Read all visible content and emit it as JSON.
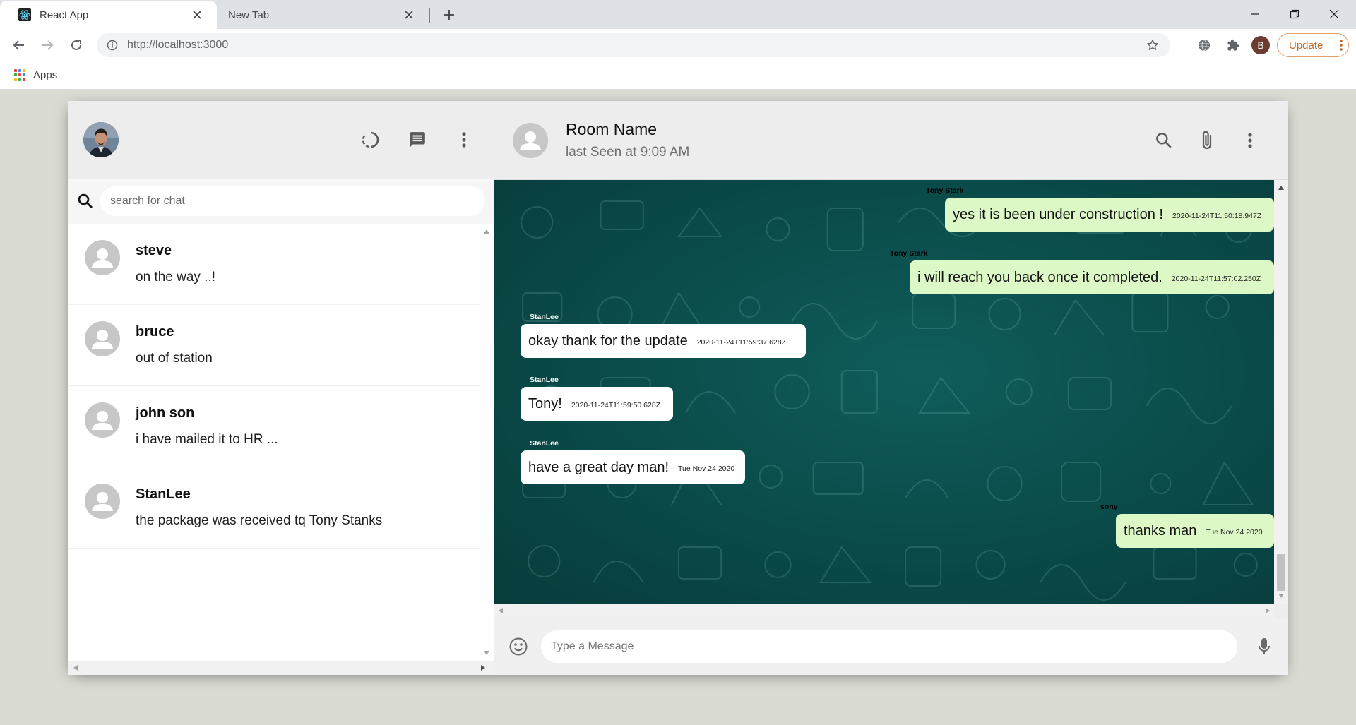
{
  "browser": {
    "tabs": [
      {
        "title": "React App",
        "active": true
      },
      {
        "title": "New Tab",
        "active": false
      }
    ],
    "url": "http://localhost:3000",
    "profile_initial": "B",
    "update_label": "Update",
    "bookmarks": [
      {
        "label": "Apps"
      }
    ]
  },
  "sidebar": {
    "search_placeholder": "search for chat",
    "chats": [
      {
        "name": "steve",
        "last_message": "on the way ..!"
      },
      {
        "name": "bruce",
        "last_message": "out of station"
      },
      {
        "name": "john son",
        "last_message": "i have mailed it to HR ..."
      },
      {
        "name": "StanLee",
        "last_message": "the package was received tq Tony Stanks"
      }
    ]
  },
  "chat": {
    "room_name": "Room Name",
    "last_seen": "last Seen at 9:09 AM",
    "input_placeholder": "Type a Message",
    "messages": [
      {
        "sender": "Tony Stark",
        "text": "yes it is been under construction !",
        "timestamp": "2020-11-24T11:50:18.947Z",
        "type": "sent"
      },
      {
        "sender": "Tony Stark",
        "text": "i will reach you back once it completed.",
        "timestamp": "2020-11-24T11:57:02.250Z",
        "type": "sent"
      },
      {
        "sender": "StanLee",
        "text": "okay thank for the update",
        "timestamp": "2020-11-24T11:59:37.628Z",
        "type": "received"
      },
      {
        "sender": "StanLee",
        "text": "Tony!",
        "timestamp": "2020-11-24T11:59:50.628Z",
        "type": "received"
      },
      {
        "sender": "StanLee",
        "text": "have a great day man!",
        "timestamp": "Tue Nov 24 2020",
        "type": "received"
      },
      {
        "sender": "sony",
        "text": "thanks man",
        "timestamp": "Tue Nov 24 2020",
        "type": "sent"
      }
    ]
  },
  "colors": {
    "sent_bubble": "#dcf8c6",
    "received_bubble": "#ffffff",
    "chat_background": "#0b4e4c",
    "header_background": "#ededed"
  }
}
